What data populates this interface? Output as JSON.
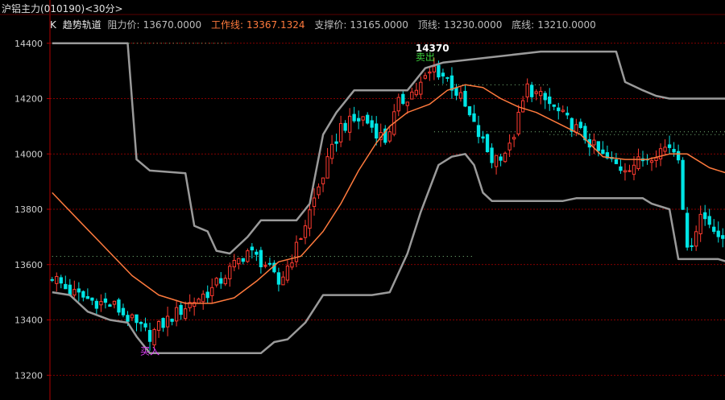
{
  "header": {
    "title": "沪铝主力",
    "code": "(010190)",
    "period": "<30分>"
  },
  "indicator": {
    "prefix": "K",
    "name": "趋势轨道",
    "resistance_label": "阻力价:",
    "resistance_value": "13670.0000",
    "work_label": "工作线:",
    "work_value": "13367.1324",
    "support_label": "支撑价:",
    "support_value": "13165.0000",
    "top_label": "顶线:",
    "top_value": "13230.0000",
    "bottom_label": "底线:",
    "bottom_value": "13210.0000"
  },
  "colors": {
    "background": "#000000",
    "up": "#ff3b30",
    "down": "#00e5e5",
    "work_line": "#ff7a3d",
    "channel": "#9a9a9a",
    "grid": "#b00000",
    "axis_text": "#cfcfcf",
    "buy": "#e040fb",
    "sell": "#3bd13b"
  },
  "chart_data": {
    "type": "line",
    "ylim": [
      13160,
      14440
    ],
    "yticks": [
      13200,
      13400,
      13600,
      13800,
      14000,
      14200,
      14400
    ],
    "grid": true,
    "n": 140,
    "annotations": [
      {
        "text": "买入",
        "bar": 22,
        "price": 13310,
        "color": "buy"
      },
      {
        "text": "卖出",
        "bar": 84,
        "price": 14338,
        "color": "sell"
      },
      {
        "text": "14370",
        "bar": 84,
        "price": 14370,
        "color": "white"
      }
    ],
    "close_anchors": [
      [
        0,
        13560
      ],
      [
        4,
        13500
      ],
      [
        9,
        13470
      ],
      [
        14,
        13450
      ],
      [
        19,
        13380
      ],
      [
        22,
        13345
      ],
      [
        26,
        13400
      ],
      [
        31,
        13460
      ],
      [
        36,
        13510
      ],
      [
        40,
        13580
      ],
      [
        44,
        13650
      ],
      [
        48,
        13600
      ],
      [
        51,
        13530
      ],
      [
        55,
        13660
      ],
      [
        60,
        13880
      ],
      [
        65,
        14100
      ],
      [
        70,
        14130
      ],
      [
        75,
        14050
      ],
      [
        78,
        14180
      ],
      [
        83,
        14250
      ],
      [
        86,
        14310
      ],
      [
        89,
        14270
      ],
      [
        92,
        14200
      ],
      [
        95,
        14100
      ],
      [
        99,
        13980
      ],
      [
        103,
        14020
      ],
      [
        107,
        14240
      ],
      [
        112,
        14180
      ],
      [
        116,
        14120
      ],
      [
        120,
        14060
      ],
      [
        124,
        13990
      ],
      [
        128,
        13950
      ],
      [
        132,
        13970
      ],
      [
        136,
        14010
      ],
      [
        139,
        14030
      ],
      [
        141,
        14000
      ],
      [
        143,
        13640
      ],
      [
        146,
        13780
      ],
      [
        149,
        13740
      ],
      [
        152,
        13640
      ]
    ],
    "upper_channel": [
      [
        0,
        14400
      ],
      [
        17,
        14400
      ],
      [
        19,
        13980
      ],
      [
        22,
        13940
      ],
      [
        30,
        13930
      ],
      [
        32,
        13740
      ],
      [
        35,
        13720
      ],
      [
        37,
        13650
      ],
      [
        40,
        13640
      ],
      [
        44,
        13700
      ],
      [
        47,
        13760
      ],
      [
        55,
        13760
      ],
      [
        58,
        13820
      ],
      [
        61,
        14070
      ],
      [
        64,
        14150
      ],
      [
        68,
        14230
      ],
      [
        80,
        14230
      ],
      [
        84,
        14310
      ],
      [
        88,
        14330
      ],
      [
        110,
        14370
      ],
      [
        127,
        14370
      ],
      [
        129,
        14260
      ],
      [
        133,
        14230
      ],
      [
        136,
        14210
      ],
      [
        139,
        14200
      ],
      [
        152,
        14200
      ]
    ],
    "lower_channel": [
      [
        0,
        13500
      ],
      [
        4,
        13490
      ],
      [
        8,
        13430
      ],
      [
        13,
        13400
      ],
      [
        17,
        13390
      ],
      [
        19,
        13340
      ],
      [
        22,
        13280
      ],
      [
        32,
        13280
      ],
      [
        47,
        13280
      ],
      [
        50,
        13320
      ],
      [
        53,
        13330
      ],
      [
        57,
        13390
      ],
      [
        61,
        13490
      ],
      [
        72,
        13490
      ],
      [
        76,
        13500
      ],
      [
        80,
        13640
      ],
      [
        83,
        13790
      ],
      [
        87,
        13960
      ],
      [
        90,
        13990
      ],
      [
        93,
        14000
      ],
      [
        95,
        13960
      ],
      [
        97,
        13860
      ],
      [
        99,
        13830
      ],
      [
        115,
        13830
      ],
      [
        118,
        13840
      ],
      [
        133,
        13840
      ],
      [
        135,
        13820
      ],
      [
        139,
        13800
      ],
      [
        141,
        13620
      ],
      [
        150,
        13620
      ],
      [
        152,
        13610
      ]
    ],
    "work_line": [
      [
        0,
        13860
      ],
      [
        6,
        13760
      ],
      [
        12,
        13660
      ],
      [
        18,
        13560
      ],
      [
        24,
        13490
      ],
      [
        30,
        13460
      ],
      [
        36,
        13460
      ],
      [
        41,
        13480
      ],
      [
        46,
        13540
      ],
      [
        51,
        13610
      ],
      [
        56,
        13630
      ],
      [
        61,
        13720
      ],
      [
        65,
        13820
      ],
      [
        69,
        13940
      ],
      [
        73,
        14040
      ],
      [
        76,
        14100
      ],
      [
        80,
        14150
      ],
      [
        85,
        14180
      ],
      [
        89,
        14230
      ],
      [
        93,
        14250
      ],
      [
        97,
        14240
      ],
      [
        101,
        14200
      ],
      [
        105,
        14170
      ],
      [
        109,
        14150
      ],
      [
        114,
        14110
      ],
      [
        119,
        14070
      ],
      [
        124,
        13990
      ],
      [
        129,
        13980
      ],
      [
        134,
        13980
      ],
      [
        139,
        14000
      ],
      [
        143,
        14000
      ],
      [
        148,
        13950
      ],
      [
        152,
        13930
      ]
    ],
    "dotted_levels": [
      {
        "price": 14400,
        "from": 0,
        "to": 40
      },
      {
        "price": 13630,
        "from": 0,
        "to": 95
      },
      {
        "price": 14250,
        "from": 86,
        "to": 112
      },
      {
        "price": 14080,
        "from": 86,
        "to": 152
      },
      {
        "price": 14070,
        "from": 112,
        "to": 152
      }
    ]
  }
}
